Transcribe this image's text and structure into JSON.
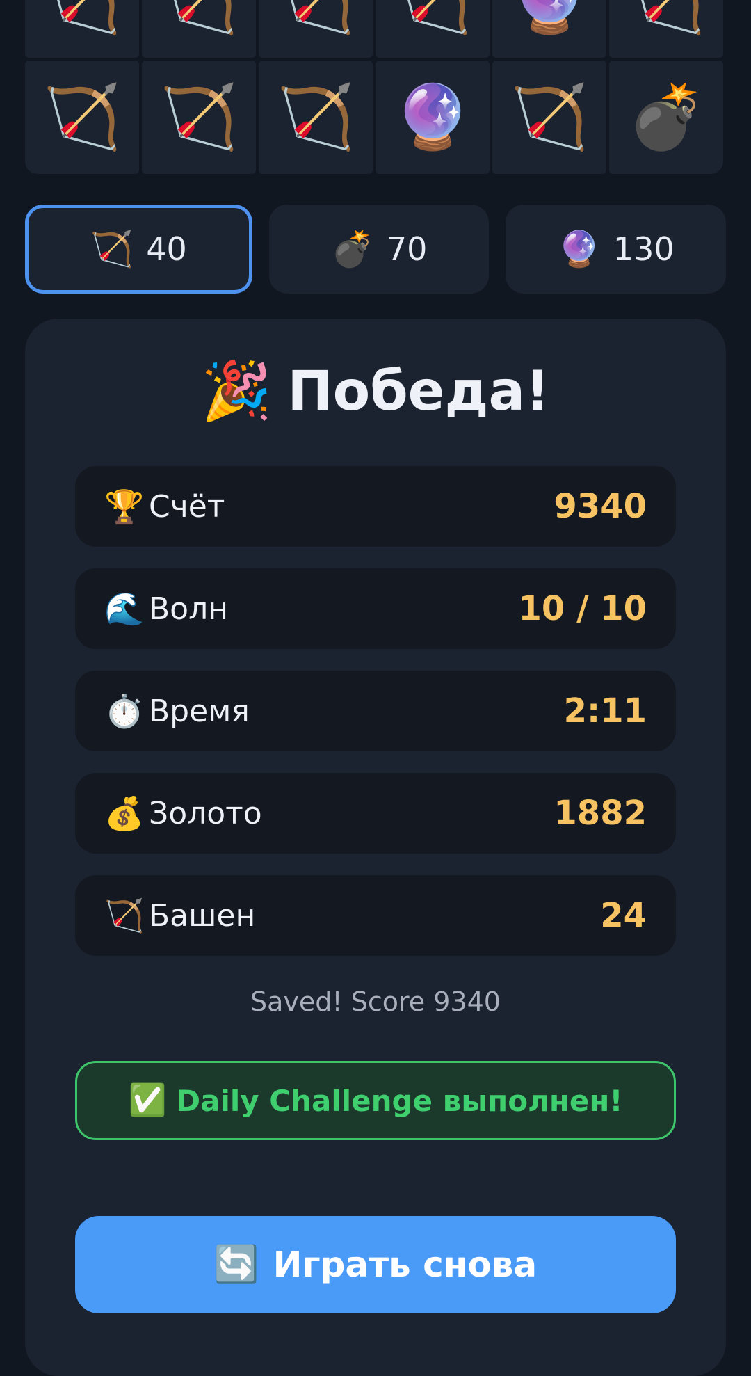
{
  "grid": {
    "cells": [
      "🏹",
      "🏹",
      "🏹",
      "🏹",
      "🔮",
      "🏹",
      "🏹",
      "🏹",
      "🏹",
      "🔮",
      "🏹",
      "💣"
    ]
  },
  "towers": [
    {
      "icon": "🏹",
      "cost": "40",
      "selected": true
    },
    {
      "icon": "💣",
      "cost": "70",
      "selected": false
    },
    {
      "icon": "🔮",
      "cost": "130",
      "selected": false
    }
  ],
  "result": {
    "title_icon": "🎉",
    "title": "Победа!",
    "stats": [
      {
        "icon": "🏆",
        "label": "Счёт",
        "value": "9340"
      },
      {
        "icon": "🌊",
        "label": "Волн",
        "value": "10 / 10"
      },
      {
        "icon": "⏱️",
        "label": "Время",
        "value": "2:11"
      },
      {
        "icon": "💰",
        "label": "Золото",
        "value": "1882"
      },
      {
        "icon": "🏹",
        "label": "Башен",
        "value": "24"
      }
    ],
    "saved_text": "Saved! Score 9340",
    "daily_icon": "✅",
    "daily_text": "Daily Challenge выполнен!",
    "play_icon": "🔄",
    "play_label": "Играть снова"
  },
  "colors": {
    "background": "#111721",
    "card": "#1c2330",
    "accent": "#4a9af8",
    "value": "#f6c262",
    "success": "#3fcf6f"
  }
}
